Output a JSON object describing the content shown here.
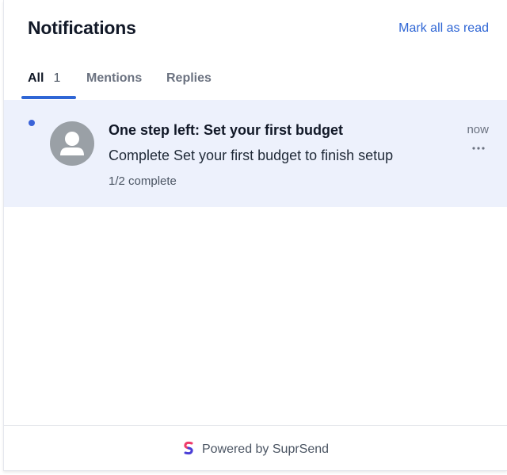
{
  "header": {
    "title": "Notifications",
    "mark_all_label": "Mark all as read"
  },
  "tabs": [
    {
      "label": "All",
      "badge": "1",
      "active": true
    },
    {
      "label": "Mentions",
      "active": false
    },
    {
      "label": "Replies",
      "active": false
    }
  ],
  "notifications": [
    {
      "title": "One step left: Set your first budget",
      "body": "Complete Set your first budget to finish setup",
      "progress": "1/2 complete",
      "time": "now",
      "unread": true,
      "avatar_icon": "user-icon",
      "menu_icon": "more-horizontal-icon"
    }
  ],
  "footer": {
    "powered_by": "Powered by SuprSend",
    "logo_icon": "suprsend-logo-icon"
  },
  "colors": {
    "accent": "#2f66d5",
    "unread_dot": "#3a63d8",
    "unread_background": "#edf1fc",
    "avatar": "#9aa0a6"
  }
}
